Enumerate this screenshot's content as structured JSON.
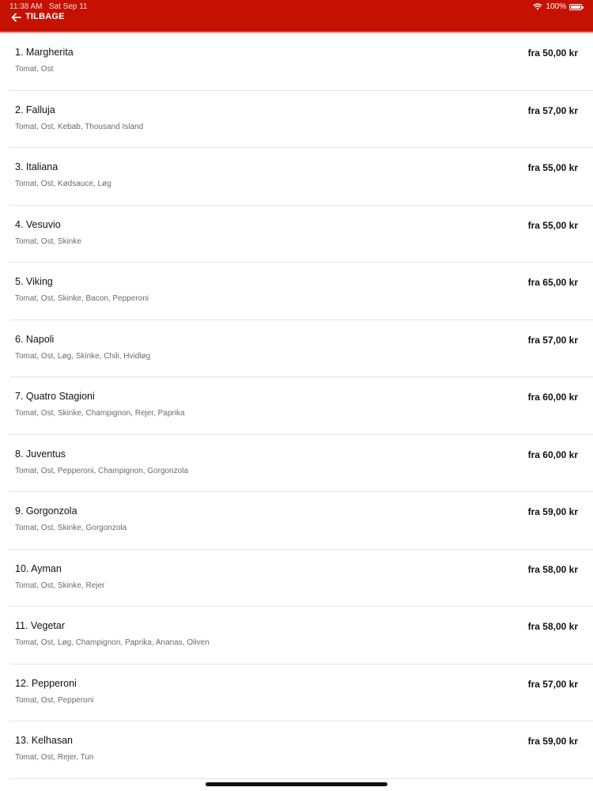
{
  "status_bar": {
    "time": "11:38 AM",
    "date": "Sat Sep 11",
    "battery": "100%",
    "icons": [
      "wifi-icon",
      "battery-icon"
    ]
  },
  "header": {
    "back_label": "TILBAGE",
    "back_icon": "arrow-left-icon",
    "background_color": "#c51102"
  },
  "menu": {
    "items": [
      {
        "name": "1. Margherita",
        "ingredients": "Tomat, Ost",
        "price": "fra 50,00 kr"
      },
      {
        "name": "2. Falluja",
        "ingredients": "Tomat, Ost, Kebab, Thousand Island",
        "price": "fra 57,00 kr"
      },
      {
        "name": "3. Italiana",
        "ingredients": "Tomat, Ost, Kødsauce, Løg",
        "price": "fra 55,00 kr"
      },
      {
        "name": "4. Vesuvio",
        "ingredients": "Tomat, Ost, Skinke",
        "price": "fra 55,00 kr"
      },
      {
        "name": "5. Viking",
        "ingredients": "Tomat, Ost, Skinke, Bacon, Pepperoni",
        "price": "fra 65,00 kr"
      },
      {
        "name": "6. Napoli",
        "ingredients": "Tomat, Ost, Løg, Skinke, Chili, Hvidløg",
        "price": "fra 57,00 kr"
      },
      {
        "name": "7. Quatro Stagioni",
        "ingredients": "Tomat, Ost, Skinke, Champignon, Rejer, Paprika",
        "price": "fra 60,00 kr"
      },
      {
        "name": "8. Juventus",
        "ingredients": "Tomat, Ost, Pepperoni, Champignon, Gorgonzola",
        "price": "fra 60,00 kr"
      },
      {
        "name": "9. Gorgonzola",
        "ingredients": "Tomat, Ost, Skinke, Gorgonzola",
        "price": "fra 59,00 kr"
      },
      {
        "name": "10. Ayman",
        "ingredients": "Tomat, Ost, Skinke, Rejer",
        "price": "fra 58,00 kr"
      },
      {
        "name": "11. Vegetar",
        "ingredients": "Tomat, Ost, Løg, Champignon, Paprika, Ananas, Oliven",
        "price": "fra 58,00 kr"
      },
      {
        "name": "12. Pepperoni",
        "ingredients": "Tomat, Ost, Pepperoni",
        "price": "fra 57,00 kr"
      },
      {
        "name": "13. Kelhasan",
        "ingredients": "Tomat, Ost, Rejer, Tun",
        "price": "fra 59,00 kr"
      }
    ]
  }
}
